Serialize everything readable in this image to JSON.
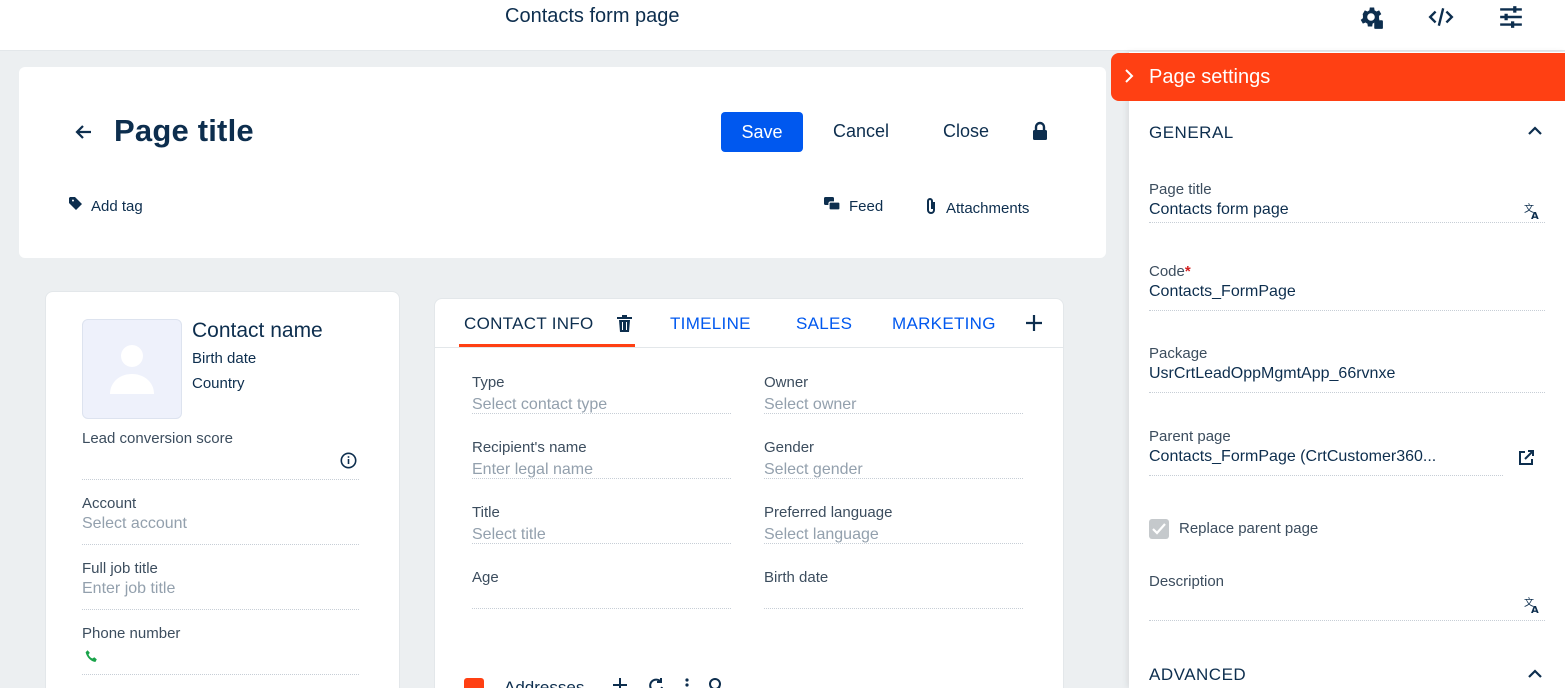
{
  "topbar": {
    "title": "Contacts form page",
    "icons": [
      "settings-gear-icon",
      "code-icon",
      "sliders-icon"
    ]
  },
  "header": {
    "page_title": "Page title",
    "save_label": "Save",
    "cancel_label": "Cancel",
    "close_label": "Close",
    "add_tag_label": "Add tag",
    "feed_label": "Feed",
    "attachments_label": "Attachments"
  },
  "profile": {
    "contact_name": "Contact name",
    "birth_date": "Birth date",
    "country": "Country",
    "fields": [
      {
        "label": "Lead conversion score",
        "value": ""
      },
      {
        "label": "Account",
        "value": "Select account"
      },
      {
        "label": "Full job title",
        "value": "Enter job title"
      },
      {
        "label": "Phone number",
        "value": ""
      }
    ]
  },
  "tabs": {
    "items": [
      "CONTACT INFO",
      "TIMELINE",
      "SALES",
      "MARKETING"
    ]
  },
  "contact_info": {
    "fields": [
      {
        "label": "Type",
        "value": "Select contact type"
      },
      {
        "label": "Owner",
        "value": "Select owner"
      },
      {
        "label": "Recipient's name",
        "value": "Enter legal name"
      },
      {
        "label": "Gender",
        "value": "Select gender"
      },
      {
        "label": "Title",
        "value": "Select title"
      },
      {
        "label": "Preferred language",
        "value": "Select language"
      },
      {
        "label": "Age",
        "value": ""
      },
      {
        "label": "Birth date",
        "value": ""
      }
    ],
    "addresses_label": "Addresses"
  },
  "page_settings": {
    "title": "Page settings",
    "general_label": "GENERAL",
    "advanced_label": "ADVANCED",
    "fields": {
      "page_title": {
        "label": "Page title",
        "value": "Contacts form page"
      },
      "code": {
        "label": "Code",
        "required_mark": "*",
        "value": "Contacts_FormPage"
      },
      "package": {
        "label": "Package",
        "value": "UsrCrtLeadOppMgmtApp_66rvnxe"
      },
      "parent_page": {
        "label": "Parent page",
        "value": "Contacts_FormPage (CrtCustomer360..."
      },
      "description": {
        "label": "Description",
        "value": ""
      }
    },
    "replace_parent_label": "Replace parent page",
    "replace_parent_checked": true
  },
  "colors": {
    "accent": "#ff4013",
    "primary": "#0058ef",
    "text": "#0d2e4e"
  }
}
